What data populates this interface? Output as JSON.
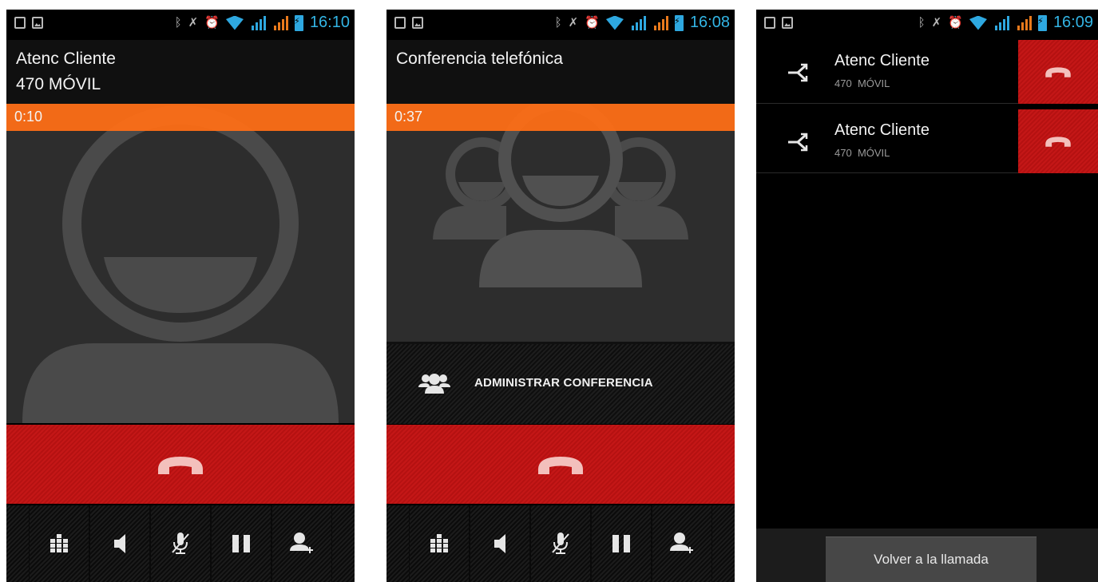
{
  "screens": [
    {
      "status": {
        "time": "16:10"
      },
      "caller": {
        "name": "Atenc Cliente",
        "subtitle": "470 MÓVIL"
      },
      "timer": "0:10",
      "photo": "contact-placeholder"
    },
    {
      "status": {
        "time": "16:08"
      },
      "caller": {
        "name": "Conferencia telefónica"
      },
      "timer": "0:37",
      "photo": "conference-placeholder",
      "manage_label": "ADMINISTRAR CONFERENCIA"
    },
    {
      "status": {
        "time": "16:09"
      },
      "participants": [
        {
          "name": "Atenc Cliente",
          "number": "470",
          "type": "MÓVIL"
        },
        {
          "name": "Atenc Cliente",
          "number": "470",
          "type": "MÓVIL"
        }
      ],
      "return_label": "Volver a la llamada"
    }
  ],
  "controls": [
    "dialpad-icon",
    "speaker-icon",
    "mute-icon",
    "hold-icon",
    "add-call-icon"
  ],
  "colors": {
    "accent": "#33b5e5",
    "timer_bar": "#fd6e16",
    "end_call": "#c41717",
    "end_icon": "#f3c0bc"
  }
}
